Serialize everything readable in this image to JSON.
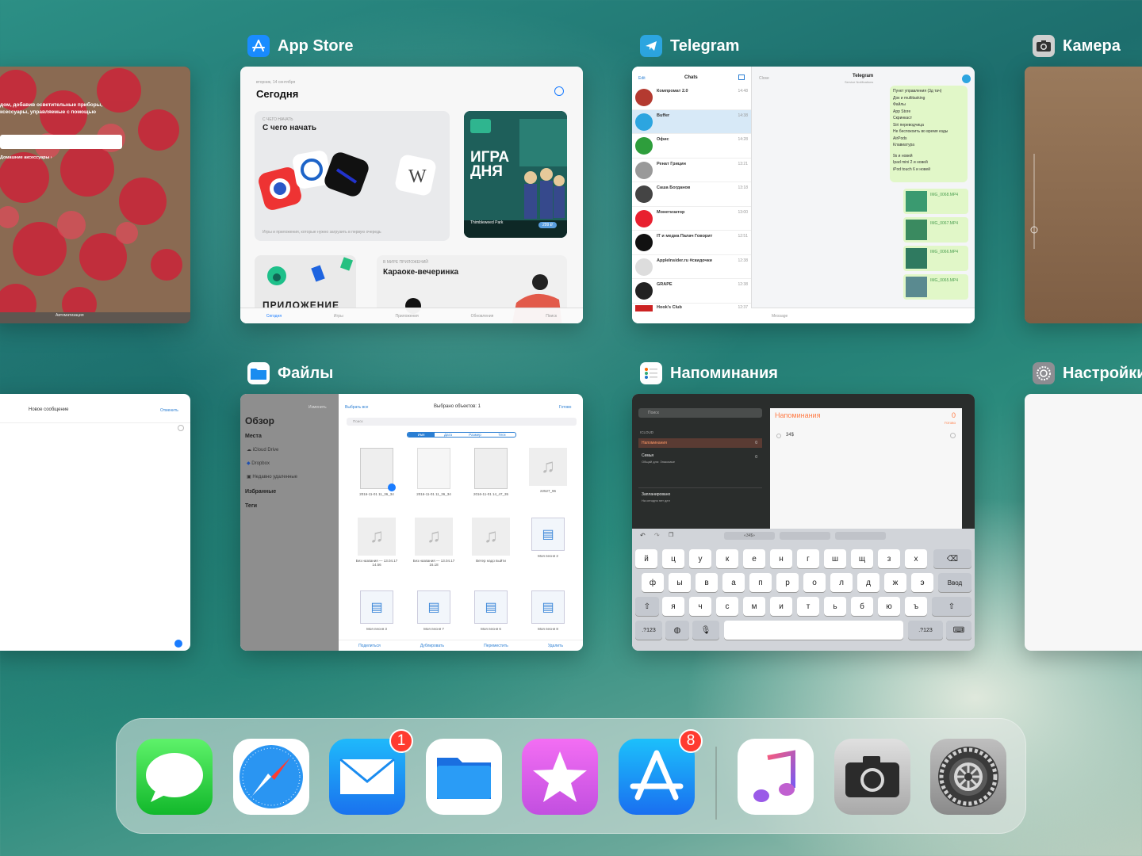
{
  "switcher": {
    "row1": [
      {
        "name": "App Store",
        "icon": "app-store-icon"
      },
      {
        "name": "Telegram",
        "icon": "telegram-icon"
      },
      {
        "name": "Камера",
        "icon": "camera-icon"
      }
    ],
    "row2": [
      {
        "name": "Файлы",
        "icon": "files-icon"
      },
      {
        "name": "Напоминания",
        "icon": "reminders-icon"
      },
      {
        "name": "Настройки",
        "icon": "settings-icon"
      }
    ]
  },
  "home_card": {
    "text_line1": "дом, добавив осветительные приборы,",
    "text_line2": "ксессуары, управляемые с помощью",
    "link": "Домашние аксессуары ›",
    "footer": "Автоматизация"
  },
  "appstore": {
    "date": "вторник, 14 сентября",
    "title": "Сегодня",
    "card1_kicker": "С ЧЕГО НАЧАТЬ",
    "card1_title": "С чего начать",
    "card1_caption": "Игры и приложения, которые нужно загрузить в первую очередь",
    "card2_title": "ИГРА ДНЯ",
    "card2_game": "Thimbleweed Park",
    "card2_price": "299 ₽",
    "card3_title": "ПРИЛОЖЕНИЕ",
    "card4_kicker": "В МИРЕ ПРИЛОЖЕНИЙ",
    "card4_title": "Караоке-вечеринка",
    "tabs": [
      "Сегодня",
      "Игры",
      "Приложения",
      "Обновления",
      "Поиск"
    ]
  },
  "telegram": {
    "edit": "Edit",
    "chats_title": "Chats",
    "close": "Close",
    "chat_title": "Telegram",
    "chat_subtitle": "Service Notifications",
    "chats": [
      {
        "name": "Компромат 2.0",
        "time": "14:48"
      },
      {
        "name": "Buffer",
        "time": "14:38"
      },
      {
        "name": "Офис",
        "time": "14:28"
      },
      {
        "name": "Ренат Грицин",
        "time": "13:21"
      },
      {
        "name": "Саша Богданов",
        "time": "13:18"
      },
      {
        "name": "Монетизатор",
        "time": "13:00"
      },
      {
        "name": "IT и медиа Палач Говорит",
        "time": "12:51"
      },
      {
        "name": "AppleInsider.ru #скидочки",
        "time": "12:38"
      },
      {
        "name": "GRAPE",
        "time": "12:38"
      },
      {
        "name": "Hook's Club",
        "time": "12:37"
      }
    ],
    "bubble_lines": [
      "Пункт управления (3д тач)",
      "Док и multitasking",
      "Файлы",
      "App Store",
      "Скринкаст",
      "Siri переводчица",
      "Не беспокоить во время езды",
      "AirPods",
      "Клавиатура",
      "",
      "9s и новей",
      "Ipad mini 2 и новей",
      "iPod touch 6 и новей"
    ],
    "files": [
      "IMG_0068.MP4",
      "IMG_0067.MP4",
      "IMG_0066.MP4",
      "IMG_0065.MP4"
    ],
    "message_placeholder": "Message"
  },
  "files": {
    "select_all": "Выбрать все",
    "selected": "Выбрано объектов: 1",
    "done": "Готово",
    "edit": "Изменить",
    "search": "Поиск",
    "sidebar_title": "Обзор",
    "places": "Места",
    "icloud": "iCloud Drive",
    "dropbox": "Dropbox",
    "deleted": "Недавно удаленные",
    "favorites": "Избранные",
    "tags": "Теги",
    "segments": [
      "Имя",
      "Дата",
      "Размер",
      "Теги"
    ],
    "items": [
      "2016-11-01 11_36_34",
      "2016-11-01 11_36_34",
      "2016-11-01 14_47_35",
      "22527_96",
      "Без названия — 13.04.17 14.56",
      "Без названия — 13.04.17 16.18",
      "Ветер надо выйти",
      "Моя песня 2",
      "Моя песня 3",
      "Моя песня 7",
      "Моя песня 6",
      "Моя песня 8"
    ],
    "toolbar": [
      "Поделиться",
      "Дублировать",
      "Переместить",
      "Удалить"
    ]
  },
  "reminders": {
    "search": "Поиск",
    "section": "ICLOUD",
    "list1": "Напоминания",
    "list2": "Семья",
    "list2_sub": "Общий для: Знакомые",
    "list2_count": "0",
    "scheduled": "Запланировано",
    "scheduled_sub": "На сегодня нет дел",
    "title": "Напоминания",
    "count": "0",
    "done": "Готово",
    "entry": "34$",
    "suggestion": "«34$»",
    "keys_row1": [
      "й",
      "ц",
      "у",
      "к",
      "е",
      "н",
      "г",
      "ш",
      "щ",
      "з",
      "х"
    ],
    "keys_row2": [
      "ф",
      "ы",
      "в",
      "а",
      "п",
      "р",
      "о",
      "л",
      "д",
      "ж",
      "э"
    ],
    "keys_row3": [
      "я",
      "ч",
      "с",
      "м",
      "и",
      "т",
      "ь",
      "б",
      "ю",
      "ъ"
    ],
    "enter": "Ввод",
    "num": ".?123"
  },
  "mail_card": {
    "title": "Новое сообщение",
    "cancel": "Отменить"
  },
  "dock": {
    "apps": [
      {
        "name": "Сообщения",
        "icon": "messages-icon"
      },
      {
        "name": "Safari",
        "icon": "safari-icon"
      },
      {
        "name": "Почта",
        "icon": "mail-icon",
        "badge": "1"
      },
      {
        "name": "Файлы",
        "icon": "files-icon"
      },
      {
        "name": "iTunes Store",
        "icon": "itunes-store-icon"
      },
      {
        "name": "App Store",
        "icon": "app-store-icon",
        "badge": "8"
      },
      {
        "name": "Музыка",
        "icon": "music-icon"
      },
      {
        "name": "Камера",
        "icon": "camera-icon"
      },
      {
        "name": "Настройки",
        "icon": "settings-icon"
      }
    ]
  }
}
